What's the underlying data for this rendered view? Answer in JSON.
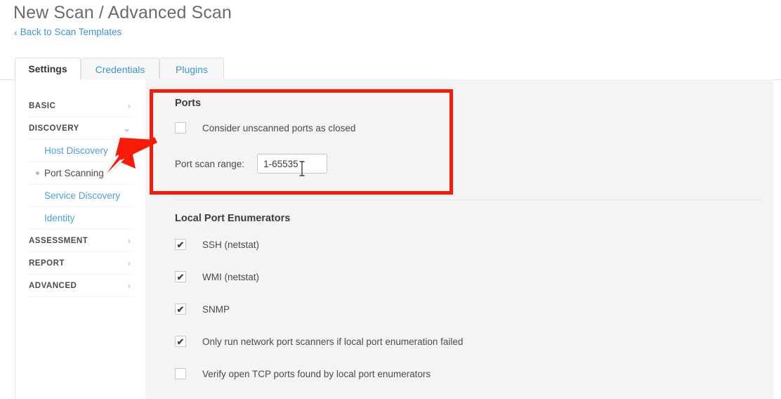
{
  "header": {
    "title": "New Scan / Advanced Scan",
    "back_link": "Back to Scan Templates",
    "back_chevron": "‹"
  },
  "tabs": [
    {
      "label": "Settings",
      "active": true
    },
    {
      "label": "Credentials",
      "active": false
    },
    {
      "label": "Plugins",
      "active": false
    }
  ],
  "sidebar": {
    "items": [
      {
        "label": "BASIC",
        "type": "section",
        "chevron": "›",
        "expanded": false
      },
      {
        "label": "DISCOVERY",
        "type": "section",
        "chevron": "⌄",
        "expanded": true
      },
      {
        "label": "Host Discovery",
        "type": "sub",
        "current": false
      },
      {
        "label": "Port Scanning",
        "type": "sub",
        "current": true
      },
      {
        "label": "Service Discovery",
        "type": "sub",
        "current": false
      },
      {
        "label": "Identity",
        "type": "sub",
        "current": false
      },
      {
        "label": "ASSESSMENT",
        "type": "section",
        "chevron": "›",
        "expanded": false
      },
      {
        "label": "REPORT",
        "type": "section",
        "chevron": "›",
        "expanded": false
      },
      {
        "label": "ADVANCED",
        "type": "section",
        "chevron": "›",
        "expanded": false
      }
    ]
  },
  "content": {
    "ports": {
      "heading": "Ports",
      "unscanned_closed_label": "Consider unscanned ports as closed",
      "unscanned_closed_checked": false,
      "port_scan_range_label": "Port scan range:",
      "port_scan_range_value": "1-65535",
      "port_scan_range_placeholder": "1-65535"
    },
    "enumerators": {
      "heading": "Local Port Enumerators",
      "items": [
        {
          "label": "SSH (netstat)",
          "checked": true
        },
        {
          "label": "WMI (netstat)",
          "checked": true
        },
        {
          "label": "SNMP",
          "checked": true
        },
        {
          "label": "Only run network port scanners if local port enumeration failed",
          "checked": true
        },
        {
          "label": "Verify open TCP ports found by local port enumerators",
          "checked": false
        }
      ]
    }
  },
  "annotation": {
    "highlight_color": "#f91b08",
    "arrow_color": "#f91b08",
    "target": "Port Scanning"
  },
  "checkmark_glyph": "✔"
}
